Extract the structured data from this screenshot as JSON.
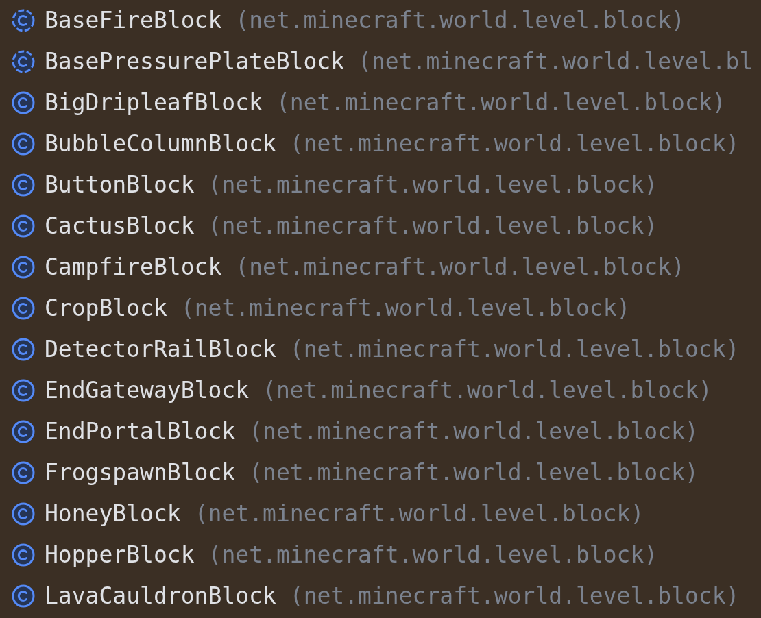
{
  "items": [
    {
      "kind": "abstract",
      "name": "BaseFireBlock",
      "package": "(net.minecraft.world.level.block)"
    },
    {
      "kind": "abstract",
      "name": "BasePressurePlateBlock",
      "package": "(net.minecraft.world.level.bl"
    },
    {
      "kind": "class",
      "name": "BigDripleafBlock",
      "package": "(net.minecraft.world.level.block)"
    },
    {
      "kind": "class",
      "name": "BubbleColumnBlock",
      "package": "(net.minecraft.world.level.block)"
    },
    {
      "kind": "class",
      "name": "ButtonBlock",
      "package": "(net.minecraft.world.level.block)"
    },
    {
      "kind": "class",
      "name": "CactusBlock",
      "package": "(net.minecraft.world.level.block)"
    },
    {
      "kind": "class",
      "name": "CampfireBlock",
      "package": "(net.minecraft.world.level.block)"
    },
    {
      "kind": "class",
      "name": "CropBlock",
      "package": "(net.minecraft.world.level.block)"
    },
    {
      "kind": "class",
      "name": "DetectorRailBlock",
      "package": "(net.minecraft.world.level.block)"
    },
    {
      "kind": "class",
      "name": "EndGatewayBlock",
      "package": "(net.minecraft.world.level.block)"
    },
    {
      "kind": "class",
      "name": "EndPortalBlock",
      "package": "(net.minecraft.world.level.block)"
    },
    {
      "kind": "class",
      "name": "FrogspawnBlock",
      "package": "(net.minecraft.world.level.block)"
    },
    {
      "kind": "class",
      "name": "HoneyBlock",
      "package": "(net.minecraft.world.level.block)"
    },
    {
      "kind": "class",
      "name": "HopperBlock",
      "package": "(net.minecraft.world.level.block)"
    },
    {
      "kind": "class",
      "name": "LavaCauldronBlock",
      "package": "(net.minecraft.world.level.block)"
    }
  ]
}
